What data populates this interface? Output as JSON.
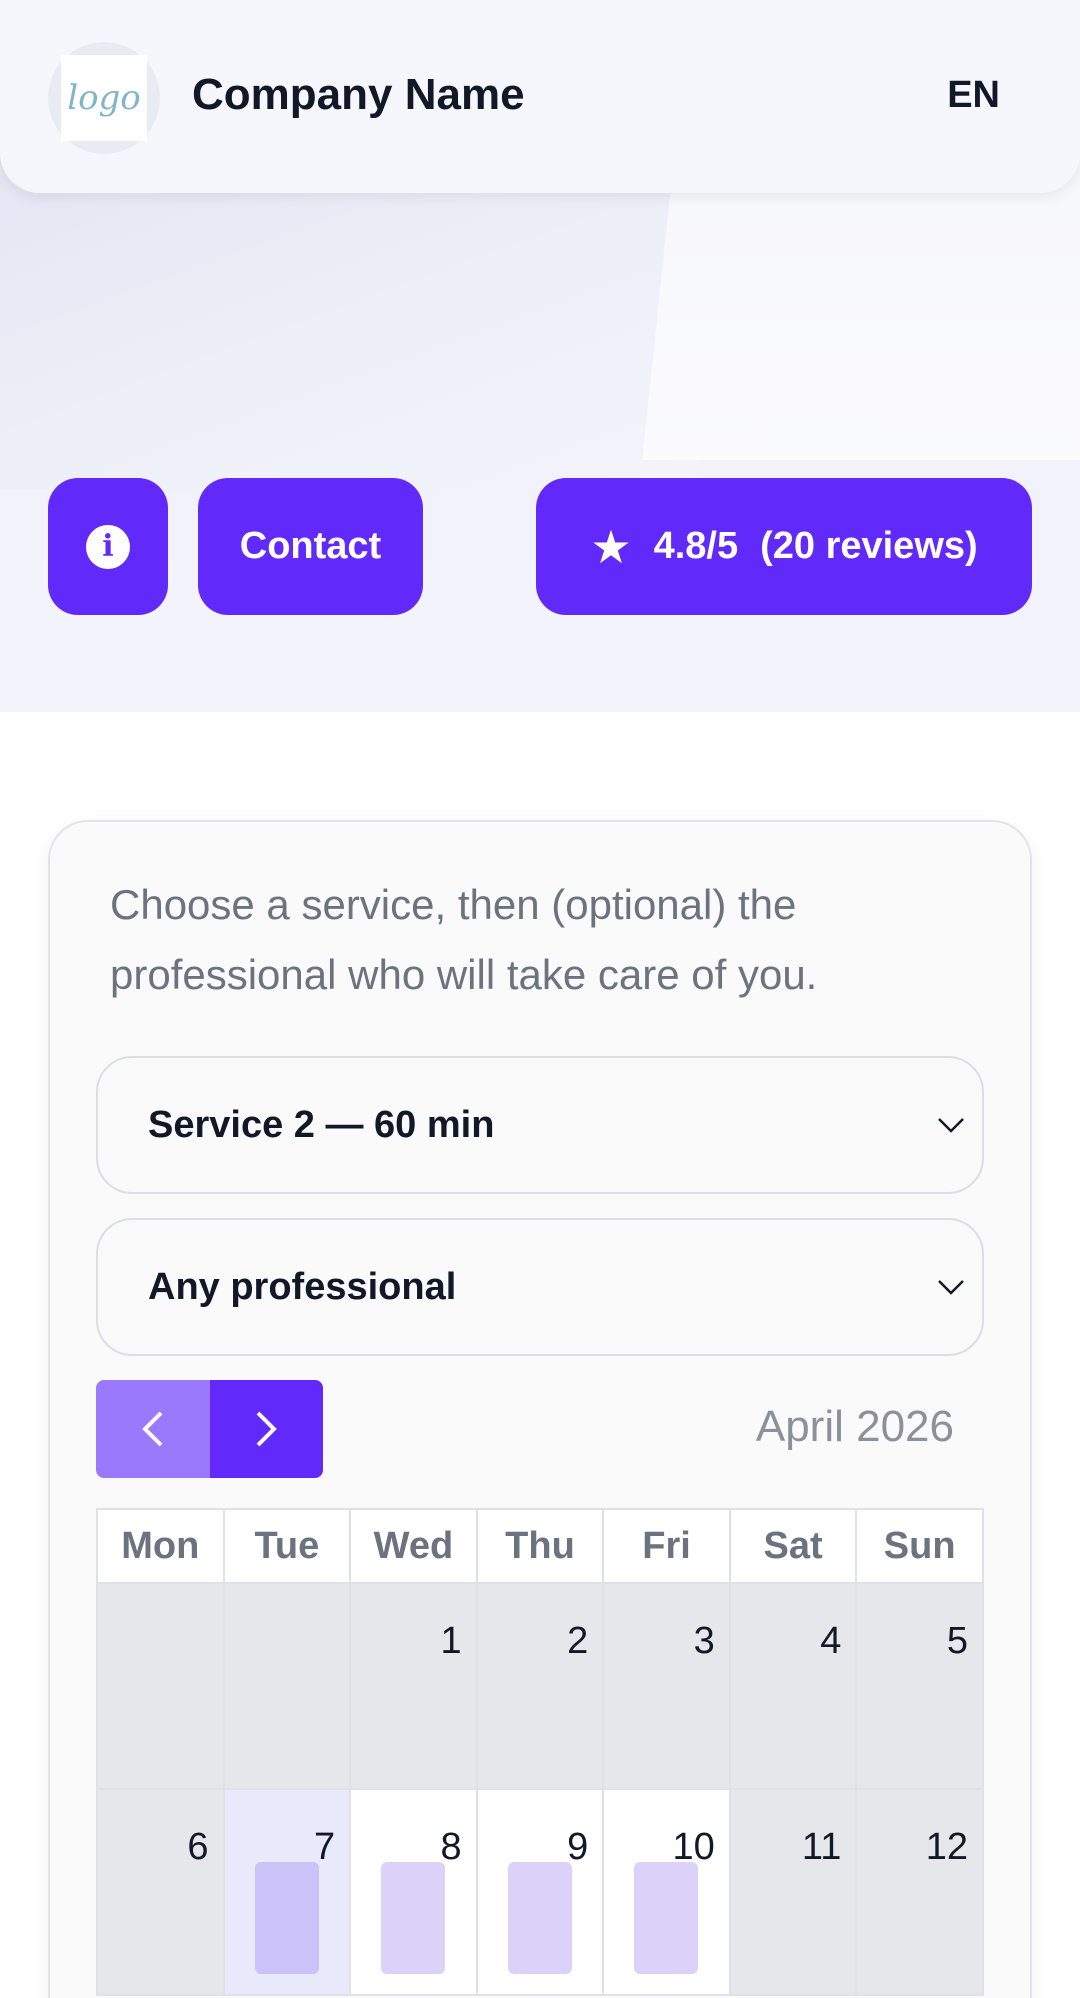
{
  "header": {
    "logo_text": "logo",
    "company_name": "Company Name",
    "language": "EN"
  },
  "actions": {
    "info_icon": "info-icon",
    "contact_label": "Contact",
    "rating": "4.8/5",
    "reviews": "(20 reviews)",
    "star_icon": "star-icon"
  },
  "colors": {
    "accent": "#6229fb",
    "accent_light": "#9b79fc",
    "text_muted": "#6b7280"
  },
  "booking": {
    "intro": "Choose a service, then (optional) the professional who will take care of you.",
    "service_select": "Service 2 — 60 min",
    "professional_select": "Any professional"
  },
  "calendar": {
    "month": "April 2026",
    "weekdays": [
      "Mon",
      "Tue",
      "Wed",
      "Thu",
      "Fri",
      "Sat",
      "Sun"
    ],
    "weeks": [
      [
        "",
        "",
        "1",
        "2",
        "3",
        "4",
        "5"
      ],
      [
        "6",
        "7",
        "8",
        "9",
        "10",
        "11",
        "12"
      ]
    ]
  }
}
